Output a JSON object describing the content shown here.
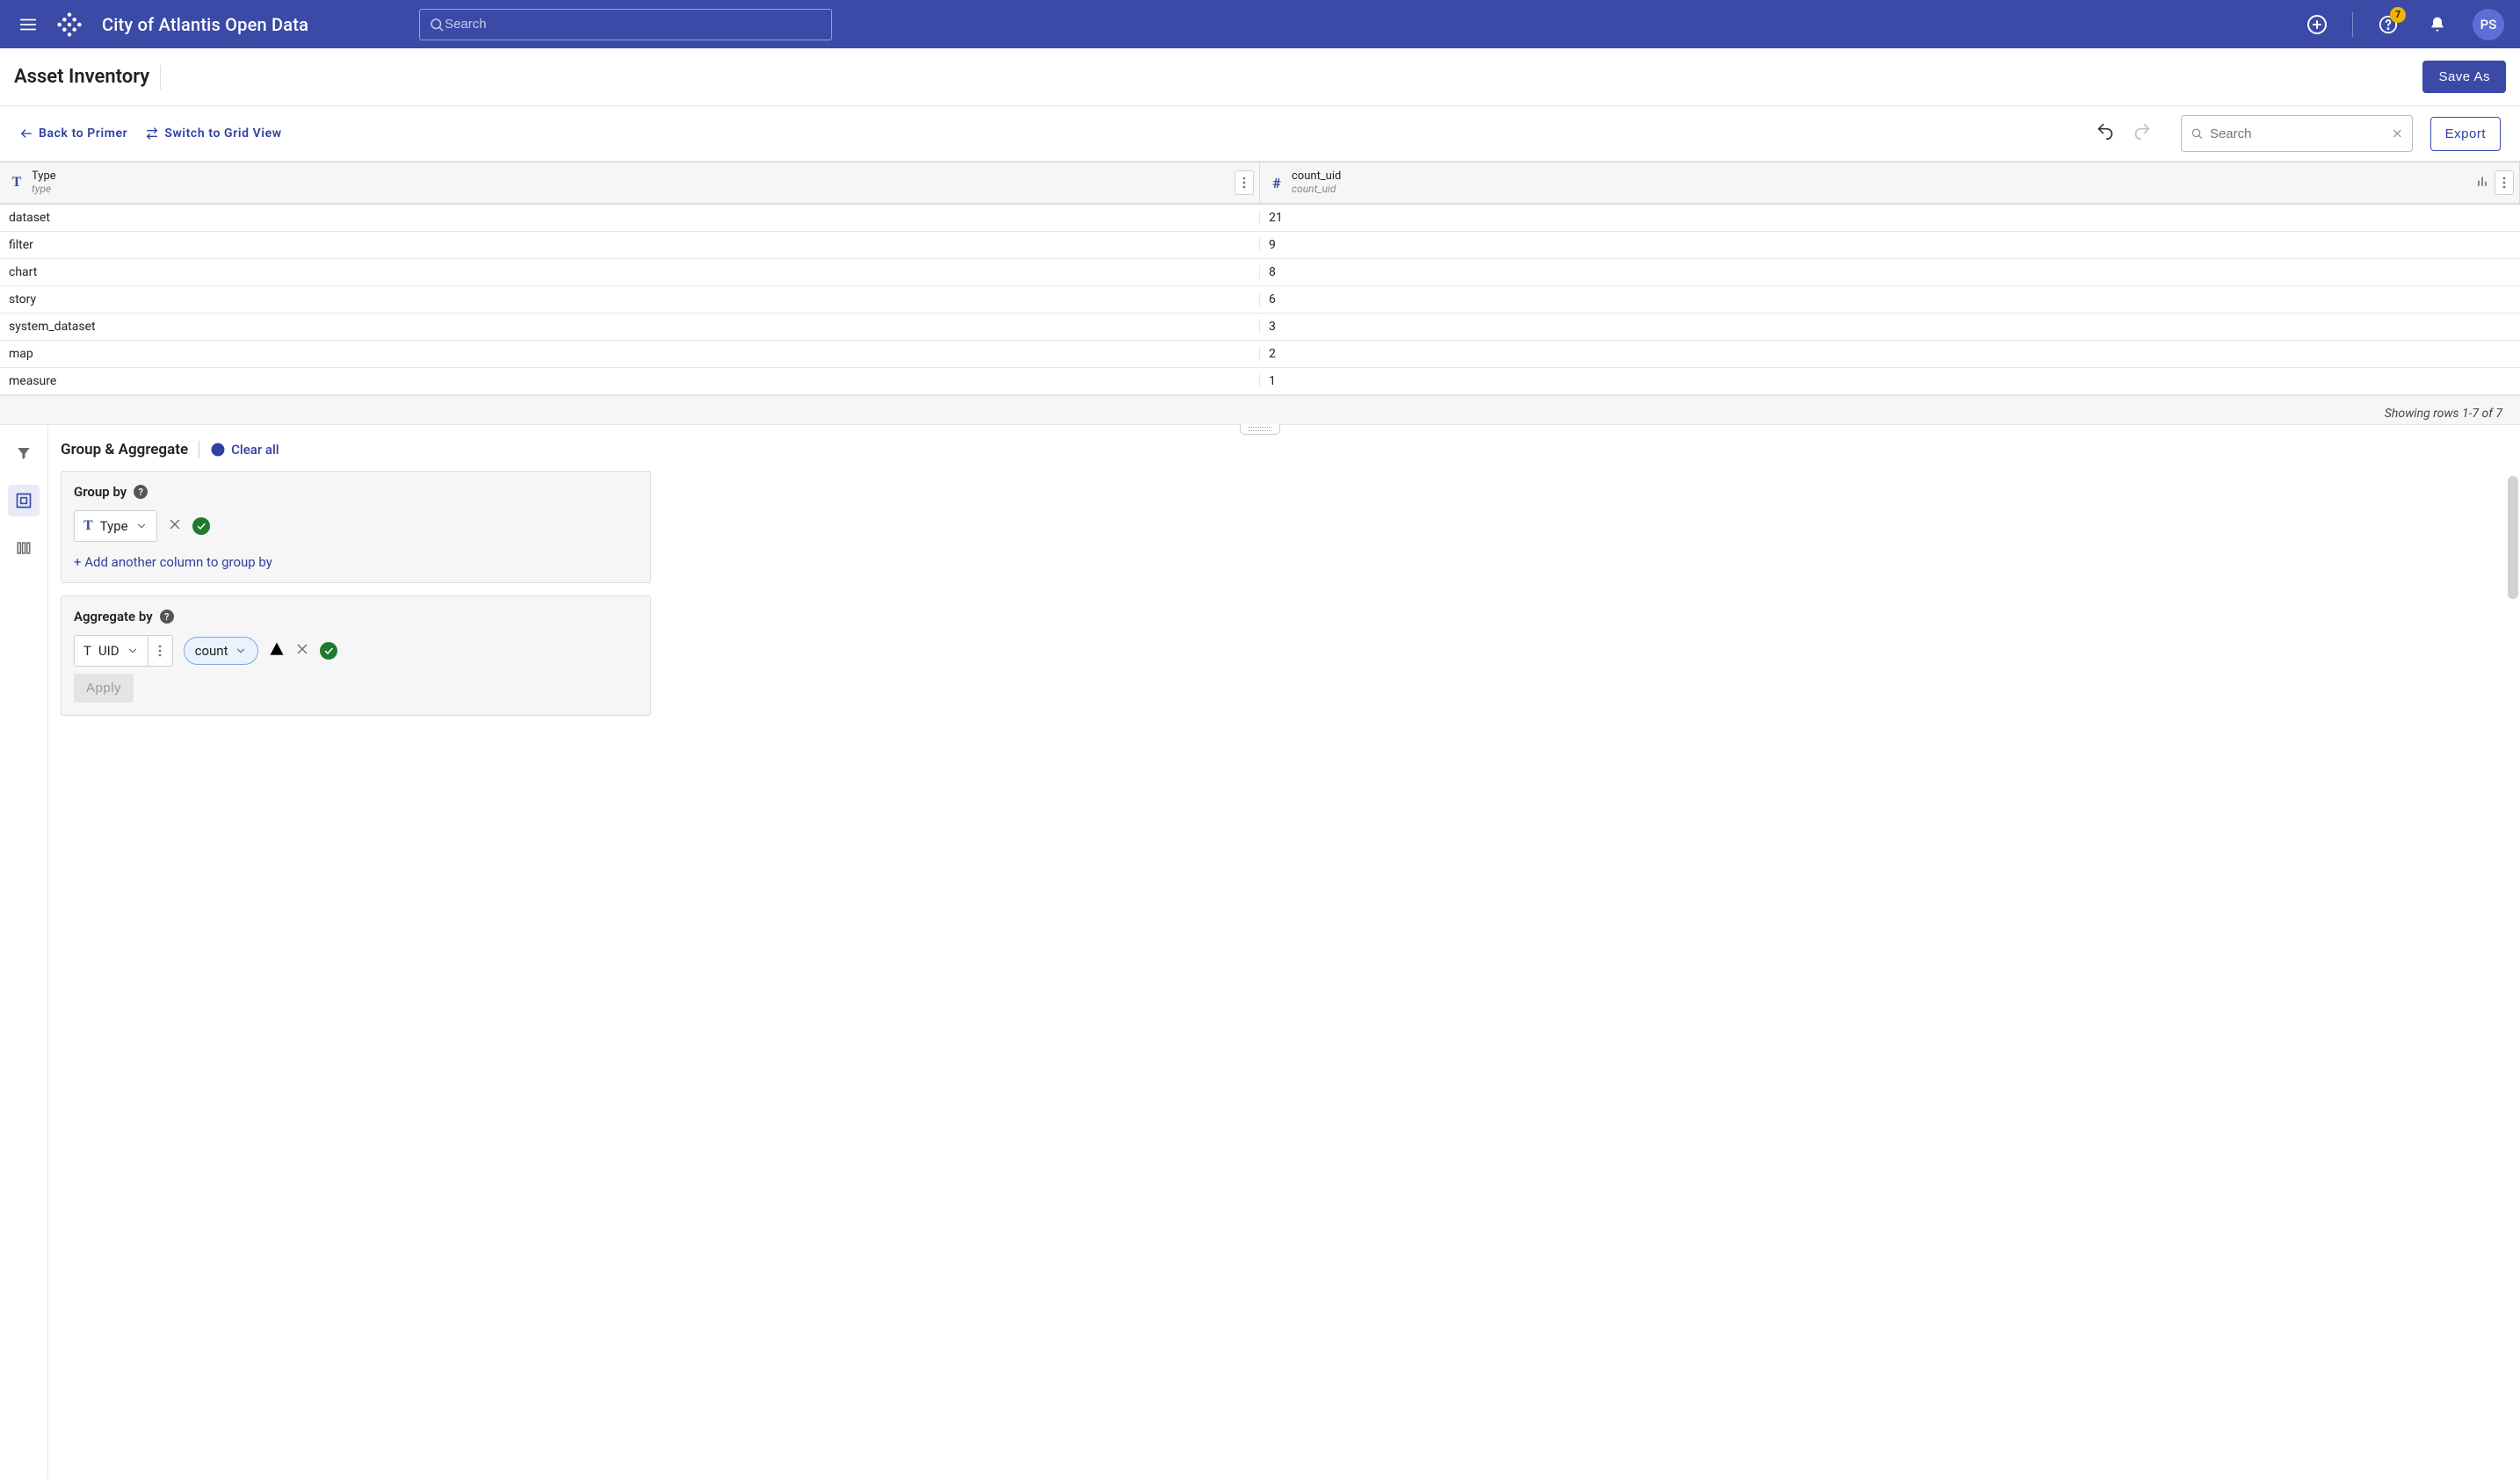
{
  "header": {
    "site_title": "City of Atlantis Open Data",
    "search_placeholder": "Search",
    "notification_count": "7",
    "avatar_initials": "PS"
  },
  "page": {
    "title": "Asset Inventory",
    "save_as_label": "Save As"
  },
  "toolbar": {
    "back_label": "Back to Primer",
    "switch_label": "Switch to Grid View",
    "search_placeholder": "Search",
    "export_label": "Export"
  },
  "table": {
    "columns": [
      {
        "title": "Type",
        "sub": "type",
        "kind": "text"
      },
      {
        "title": "count_uid",
        "sub": "count_uid",
        "kind": "number"
      }
    ],
    "rows": [
      {
        "type": "dataset",
        "count": "21"
      },
      {
        "type": "filter",
        "count": "9"
      },
      {
        "type": "chart",
        "count": "8"
      },
      {
        "type": "story",
        "count": "6"
      },
      {
        "type": "system_dataset",
        "count": "3"
      },
      {
        "type": "map",
        "count": "2"
      },
      {
        "type": "measure",
        "count": "1"
      }
    ],
    "footer": "Showing rows 1-7 of 7"
  },
  "panel": {
    "title": "Group & Aggregate",
    "clear_all_label": "Clear all",
    "group_by": {
      "title": "Group by",
      "field_label": "Type",
      "add_link": "+ Add another column to group by"
    },
    "aggregate_by": {
      "title": "Aggregate by",
      "field_label": "UID",
      "function_label": "count"
    },
    "apply_label": "Apply"
  }
}
